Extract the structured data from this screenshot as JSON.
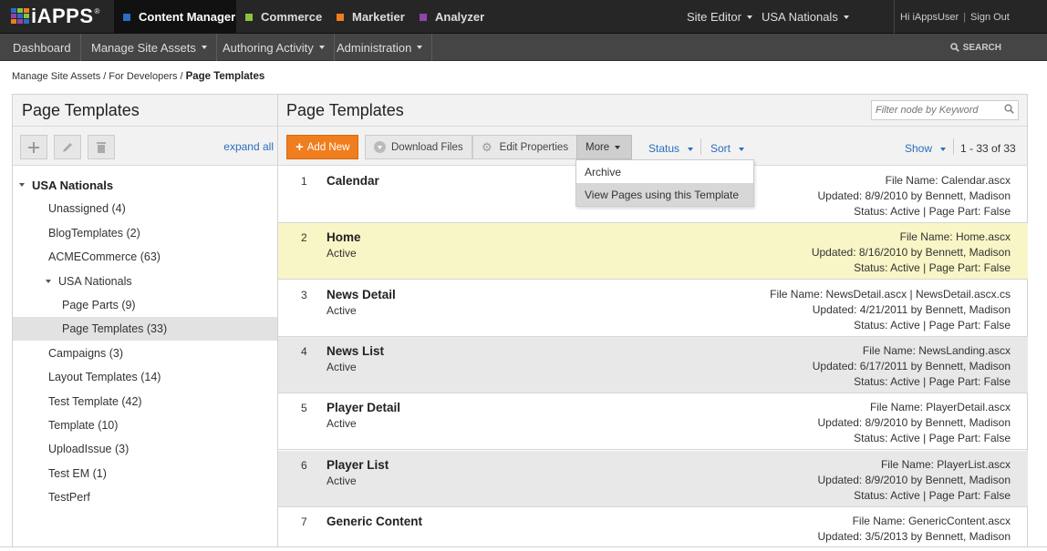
{
  "brand": {
    "logo_text": "iAPPS",
    "registered": "®",
    "grid_colors": [
      "#2b6cc4",
      "#8ac43f",
      "#f07d1e",
      "#8e44ad",
      "#2b6cc4",
      "#8ac43f",
      "#f07d1e",
      "#8e44ad",
      "#2b6cc4"
    ]
  },
  "modules": [
    {
      "label": "Content Manager",
      "color": "#2b6cc4",
      "active": true
    },
    {
      "label": "Commerce",
      "color": "#8ac43f"
    },
    {
      "label": "Marketier",
      "color": "#f07d1e"
    },
    {
      "label": "Analyzer",
      "color": "#8e44ad"
    }
  ],
  "topright": {
    "site_editor": "Site Editor",
    "site": "USA Nationals",
    "greeting": "Hi iAppsUser",
    "separator": "|",
    "signout": "Sign Out"
  },
  "nav": {
    "items": [
      "Dashboard",
      "Manage Site Assets",
      "Authoring Activity",
      "Administration"
    ],
    "search": "SEARCH"
  },
  "breadcrumb": {
    "items": [
      "Manage Site Assets",
      "For Developers"
    ],
    "separator": "/",
    "current": "Page Templates"
  },
  "left_panel": {
    "title": "Page Templates",
    "expand_all": "expand all",
    "tree": [
      {
        "label": "USA Nationals",
        "level": 0,
        "expanded": true,
        "bold": true
      },
      {
        "label": "Unassigned (4)",
        "level": 1
      },
      {
        "label": "BlogTemplates (2)",
        "level": 1
      },
      {
        "label": "ACMECommerce (63)",
        "level": 1
      },
      {
        "label": "USA Nationals",
        "level": 1,
        "expanded": true
      },
      {
        "label": "Page Parts (9)",
        "level": 2
      },
      {
        "label": "Page Templates (33)",
        "level": 2,
        "selected": true
      },
      {
        "label": "Campaigns (3)",
        "level": 1
      },
      {
        "label": "Layout Templates (14)",
        "level": 1
      },
      {
        "label": "Test Template (42)",
        "level": 1
      },
      {
        "label": "Template (10)",
        "level": 1
      },
      {
        "label": "UploadIssue (3)",
        "level": 1
      },
      {
        "label": "Test EM (1)",
        "level": 1
      },
      {
        "label": "TestPerf",
        "level": 1
      }
    ]
  },
  "main": {
    "title": "Page Templates",
    "filter_placeholder": "Filter node by Keyword",
    "toolbar": {
      "add_new": "Add New",
      "download_files": "Download Files",
      "edit_properties": "Edit Properties",
      "more": "More",
      "status": "Status",
      "sort": "Sort",
      "show": "Show",
      "pager": "1 - 33 of 33"
    },
    "more_menu": [
      "Archive",
      "View Pages using this Template"
    ],
    "rows": [
      {
        "num": "1",
        "name": "Calendar",
        "status": "",
        "file": "File Name: Calendar.ascx",
        "updated": "Updated: 8/9/2010 by Bennett, Madison",
        "meta": "Status: Active | Page Part: False",
        "style": "normal"
      },
      {
        "num": "2",
        "name": "Home",
        "status": "Active",
        "file": "File Name: Home.ascx",
        "updated": "Updated: 8/16/2010 by Bennett, Madison",
        "meta": "Status: Active | Page Part: False",
        "style": "hl"
      },
      {
        "num": "3",
        "name": "News Detail",
        "status": "Active",
        "file": "File Name: NewsDetail.ascx | NewsDetail.ascx.cs",
        "updated": "Updated: 4/21/2011 by Bennett, Madison",
        "meta": "Status: Active | Page Part: False",
        "style": "normal"
      },
      {
        "num": "4",
        "name": "News List",
        "status": "Active",
        "file": "File Name: NewsLanding.ascx",
        "updated": "Updated: 6/17/2011 by Bennett, Madison",
        "meta": "Status: Active | Page Part: False",
        "style": "alt"
      },
      {
        "num": "5",
        "name": "Player Detail",
        "status": "Active",
        "file": "File Name: PlayerDetail.ascx",
        "updated": "Updated: 8/9/2010 by Bennett, Madison",
        "meta": "Status: Active | Page Part: False",
        "style": "normal"
      },
      {
        "num": "6",
        "name": "Player List",
        "status": "Active",
        "file": "File Name: PlayerList.ascx",
        "updated": "Updated: 8/9/2010 by Bennett, Madison",
        "meta": "Status: Active | Page Part: False",
        "style": "alt"
      },
      {
        "num": "7",
        "name": "Generic Content",
        "status": "",
        "file": "File Name: GenericContent.ascx",
        "updated": "Updated: 3/5/2013 by Bennett, Madison",
        "meta": "",
        "style": "normal"
      }
    ]
  }
}
